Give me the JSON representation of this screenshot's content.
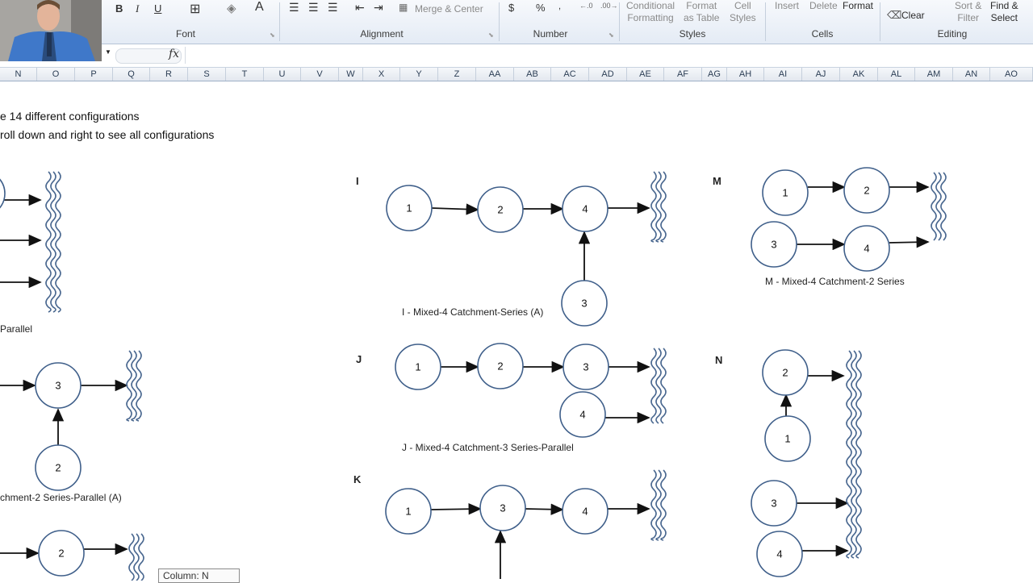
{
  "ribbon": {
    "groups": [
      "Font",
      "Alignment",
      "Number",
      "Styles",
      "Cells",
      "Editing"
    ],
    "font_buttons": [
      "B",
      "I",
      "U"
    ],
    "merge_center": "Merge & Center",
    "number_buttons": [
      "$",
      "%"
    ],
    "conditional_formatting": [
      "Conditional",
      "Formatting"
    ],
    "format_as_table": [
      "Format",
      "as Table"
    ],
    "cell_styles": [
      "Cell",
      "Styles"
    ],
    "insert": "Insert",
    "delete": "Delete",
    "format": "Format",
    "clear": "Clear",
    "sort_filter": [
      "Sort &",
      "Filter"
    ],
    "find_select": [
      "Find &",
      "Select"
    ]
  },
  "formula_bar": {
    "fx_label": "fx",
    "value": ""
  },
  "columns": [
    "N",
    "O",
    "P",
    "Q",
    "R",
    "S",
    "T",
    "U",
    "V",
    "W",
    "X",
    "Y",
    "Z",
    "AA",
    "AB",
    "AC",
    "AD",
    "AE",
    "AF",
    "AG",
    "AH",
    "AI",
    "AJ",
    "AK",
    "AL",
    "AM",
    "AN",
    "AO"
  ],
  "sheet": {
    "note_1": "e 14 different configurations",
    "note_2": "roll down and right to see all configurations",
    "labels": {
      "I": "I",
      "J": "J",
      "K": "K",
      "M": "M",
      "N": "N"
    },
    "captions": {
      "parallel": "Parallel",
      "chment": "chment-2 Series-Parallel (A)",
      "I": "I - Mixed-4 Catchment-Series (A)",
      "J": "J - Mixed-4 Catchment-3 Series-Parallel",
      "M": "M - Mixed-4 Catchment-2 Series"
    },
    "nodes": {
      "one": "1",
      "two": "2",
      "three": "3",
      "four": "4"
    }
  },
  "tooltip": "Column: N",
  "colors": {
    "node_stroke": "#3f5f8a",
    "ribbon_bg": "#e4ebf5",
    "header_border": "#9eb0c7"
  }
}
